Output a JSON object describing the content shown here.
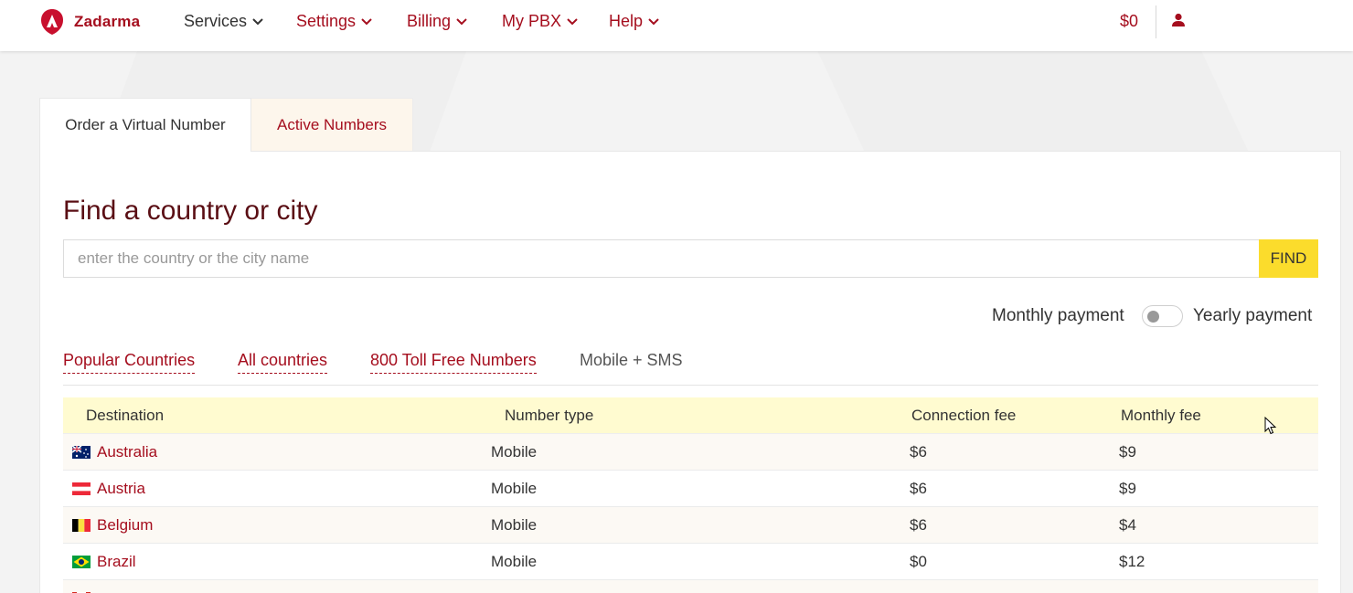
{
  "app": {
    "brand": "Zadarma"
  },
  "nav": {
    "items": [
      {
        "label": "Services"
      },
      {
        "label": "Settings"
      },
      {
        "label": "Billing"
      },
      {
        "label": "My PBX"
      },
      {
        "label": "Help"
      }
    ],
    "balance": "$0",
    "user_name": ""
  },
  "tabs": [
    {
      "label": "Order a Virtual Number"
    },
    {
      "label": "Active Numbers"
    }
  ],
  "search": {
    "title": "Find a country or city",
    "placeholder": "enter the country or the city name",
    "value": "",
    "button": "FIND"
  },
  "payment": {
    "monthly_label": "Monthly payment",
    "yearly_label": "Yearly payment",
    "yearly_selected": false
  },
  "filters": [
    {
      "label": "Popular Countries"
    },
    {
      "label": "All countries"
    },
    {
      "label": "800 Toll Free Numbers"
    },
    {
      "label": "Mobile + SMS"
    }
  ],
  "table": {
    "headers": [
      "Destination",
      "Number type",
      "Connection fee",
      "Monthly fee"
    ],
    "rows": [
      {
        "destination": "Australia",
        "type": "Mobile",
        "connection": "$6",
        "monthly": "$9",
        "flag": "au-flag-icon"
      },
      {
        "destination": "Austria",
        "type": "Mobile",
        "connection": "$6",
        "monthly": "$9",
        "flag": "at-flag-icon"
      },
      {
        "destination": "Belgium",
        "type": "Mobile",
        "connection": "$6",
        "monthly": "$4",
        "flag": "be-flag-icon"
      },
      {
        "destination": "Brazil",
        "type": "Mobile",
        "connection": "$0",
        "monthly": "$12",
        "flag": "br-flag-icon"
      }
    ]
  },
  "colors": {
    "brand": "#a50e1e",
    "find_button": "#fbdc2c",
    "table_header": "#fffbd0"
  }
}
